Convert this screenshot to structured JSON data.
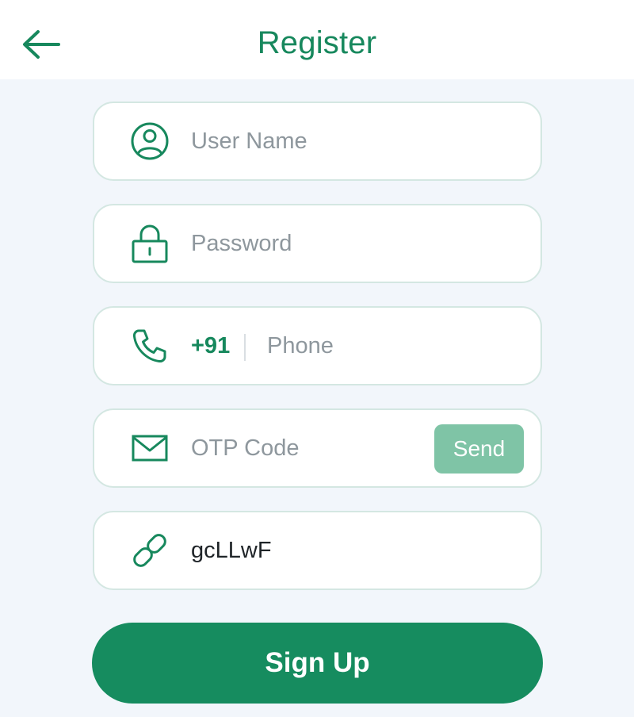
{
  "header": {
    "title": "Register",
    "back_icon": "arrow-left-icon"
  },
  "form": {
    "username": {
      "placeholder": "User Name",
      "value": "",
      "icon": "user-icon"
    },
    "password": {
      "placeholder": "Password",
      "value": "",
      "icon": "lock-icon"
    },
    "phone": {
      "country_code": "+91",
      "placeholder": "Phone",
      "value": "",
      "icon": "phone-icon"
    },
    "otp": {
      "placeholder": "OTP Code",
      "value": "",
      "icon": "mail-icon",
      "send_label": "Send"
    },
    "invite": {
      "value": "gcLLwF",
      "icon": "link-icon"
    }
  },
  "signup_label": "Sign Up",
  "colors": {
    "accent": "#17885d",
    "send_button": "#7fc4a6",
    "background": "#f2f6fb",
    "field_border": "#d4e7e2"
  }
}
